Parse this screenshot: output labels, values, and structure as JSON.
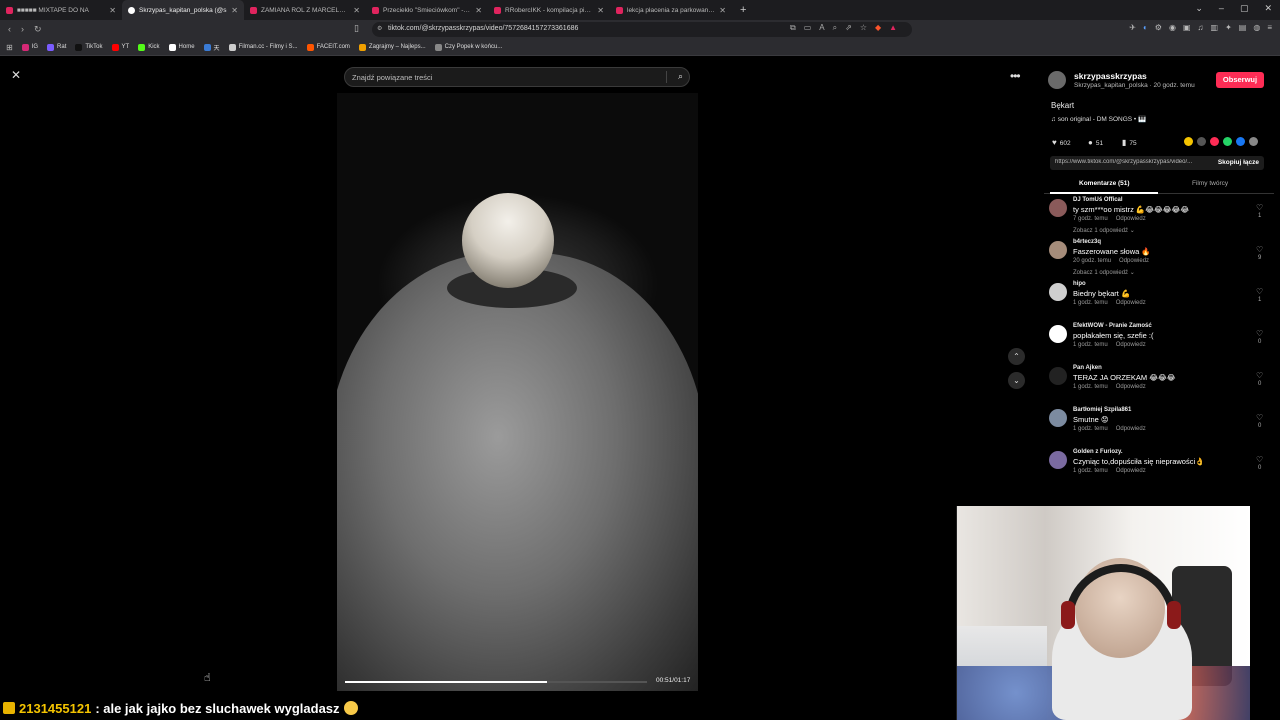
{
  "browser": {
    "tabs": [
      {
        "title": "■■■■■ MIXTAPE DO NA",
        "active": false,
        "favicon": "youtube"
      },
      {
        "title": "Skrzypas_kapitan_polska (@s",
        "active": true,
        "favicon": "tiktok"
      },
      {
        "title": "ZAMIANA RÓL Z MARCELEM - YouTu",
        "active": false,
        "favicon": "youtube"
      },
      {
        "title": "Przeciekło \"Śmieciówkom\" - YouTube",
        "active": false,
        "favicon": "youtube"
      },
      {
        "title": "RRobercIKK - kompilacja pianek - Yo",
        "active": false,
        "favicon": "youtube"
      },
      {
        "title": "lekcja płacenia za parkowanie - YouT",
        "active": false,
        "favicon": "youtube"
      }
    ],
    "url": "tiktok.com/@skrzypasskrzypas/video/7572684157273361686",
    "bookmarks": [
      {
        "label": "IG",
        "color": "#d62976"
      },
      {
        "label": "Rat",
        "color": "#7a5cff"
      },
      {
        "label": "TikTok",
        "color": "#111111"
      },
      {
        "label": "YT",
        "color": "#ff0000"
      },
      {
        "label": "Kick",
        "color": "#53fc18"
      },
      {
        "label": "Home",
        "color": "#ffffff"
      },
      {
        "label": "天",
        "color": "#3a7bd5"
      },
      {
        "label": "Filman.cc - Filmy i S...",
        "color": "#cccccc"
      },
      {
        "label": "FACEIT.com",
        "color": "#ff5500"
      },
      {
        "label": "Zagrajmy – Najleps...",
        "color": "#f0a000"
      },
      {
        "label": "Czy Popek w końcu...",
        "color": "#888888"
      }
    ]
  },
  "viewer": {
    "search_placeholder": "Znajdź powiązane treści",
    "time_label": "00:51/01:17",
    "progress_fraction": 0.67
  },
  "panel": {
    "author_name": "skrzypasskrzypas",
    "author_sub": "Skrzypas_kapitan_polska · 20 godz. temu",
    "follow_label": "Obserwuj",
    "description": "Bękart",
    "sound": "son original - DM SONGS • 🎹",
    "likes": "602",
    "comments_count": "51",
    "saves": "75",
    "link": "https://www.tiktok.com/@skrzypasskrzypas/video/...",
    "copy_label": "Skopiuj łącze",
    "tab_comments": "Komentarze (51)",
    "tab_creator": "Filmy twórcy"
  },
  "comments": [
    {
      "user": "DJ TomUś Offical",
      "text": "ty szm***oo mistrz 💪😂😂😂😂😂",
      "meta": "7 godz. temu",
      "reply": "Odpowiedz",
      "more": "Zobacz 1 odpowiedź ⌄",
      "likes": "1"
    },
    {
      "user": "b4rtecz3q",
      "text": "Faszerowane słowa 🔥",
      "meta": "20 godz. temu",
      "reply": "Odpowiedz",
      "more": "Zobacz 1 odpowiedź ⌄",
      "likes": "9"
    },
    {
      "user": "hipo",
      "text": "Biedny bękart 💪",
      "meta": "1 godz. temu",
      "reply": "Odpowiedz",
      "more": "",
      "likes": "1"
    },
    {
      "user": "EfektWOW - Pranie Zamość",
      "text": "popłakałem się, szefie :(",
      "meta": "1 godz. temu",
      "reply": "Odpowiedz",
      "more": "",
      "likes": "0"
    },
    {
      "user": "Pan Ajken",
      "text": "TERAZ JA ORZEKAM 😂😂😂",
      "meta": "1 godz. temu",
      "reply": "Odpowiedz",
      "more": "",
      "likes": "0"
    },
    {
      "user": "Bartłomiej Szpila861",
      "text": "Smutne 😟",
      "meta": "1 godz. temu",
      "reply": "Odpowiedz",
      "more": "",
      "likes": "0"
    },
    {
      "user": "Golden z Furiozy.",
      "text": "Czyniąc to,dopuściła się nieprawości👌",
      "meta": "1 godz. temu",
      "reply": "Odpowiedz",
      "more": "",
      "likes": "0"
    }
  ],
  "chat": {
    "user": "2131455121",
    "message": ": ale jak jajko bez sluchawek wygladasz"
  }
}
